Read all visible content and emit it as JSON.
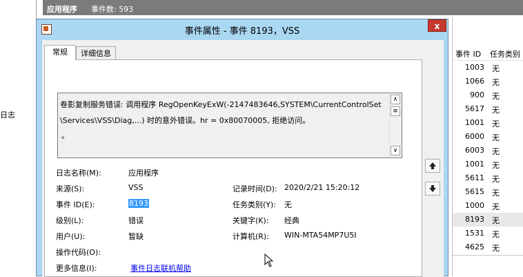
{
  "left_pane": {
    "text": "日志"
  },
  "topbar": {
    "log_name": "应用程序",
    "event_count": "事件数: 593"
  },
  "right_pane": {
    "col_event_id": "事件 ID",
    "col_task": "任务类别",
    "rows": [
      {
        "id": "1003",
        "task": "无"
      },
      {
        "id": "1066",
        "task": "无"
      },
      {
        "id": "900",
        "task": "无"
      },
      {
        "id": "5617",
        "task": "无"
      },
      {
        "id": "1001",
        "task": "无"
      },
      {
        "id": "6000",
        "task": "无"
      },
      {
        "id": "6003",
        "task": "无"
      },
      {
        "id": "1001",
        "task": "无"
      },
      {
        "id": "5611",
        "task": "无"
      },
      {
        "id": "5615",
        "task": "无"
      },
      {
        "id": "1000",
        "task": "无"
      },
      {
        "id": "8193",
        "task": "无"
      },
      {
        "id": "1531",
        "task": "无"
      },
      {
        "id": "4625",
        "task": "无"
      }
    ],
    "selected_index": 11
  },
  "dialog": {
    "title": "事件属性 - 事件 8193，VSS",
    "close_label": "x",
    "tabs": [
      "常规",
      "详细信息"
    ],
    "description_line1": "卷影复制服务错误: 调用程序 RegOpenKeyExW(-2147483646,SYSTEM\\CurrentControlSet",
    "description_line2": "\\Services\\VSS\\Diag,...) 时的意外错误。hr = 0x80070005, 拒绝访问。",
    "description_line3": "。",
    "fields": {
      "log_name_label": "日志名称(M):",
      "log_name_value": "应用程序",
      "source_label": "来源(S):",
      "source_value": "VSS",
      "logged_label": "记录时间(D):",
      "logged_value": "2020/2/21 15:20:12",
      "event_id_label": "事件 ID(E):",
      "event_id_value": "8193",
      "task_label": "任务类别(Y):",
      "task_value": "无",
      "level_label": "级别(L):",
      "level_value": "错误",
      "keywords_label": "关键字(K):",
      "keywords_value": "经典",
      "user_label": "用户(U):",
      "user_value": "暂缺",
      "computer_label": "计算机(R):",
      "computer_value": "WIN-MTA54MP7U5I",
      "opcode_label": "操作代码(O):",
      "opcode_value": "",
      "more_info_label": "更多信息(I):",
      "more_info_link": "事件日志联机帮助"
    }
  },
  "colors": {
    "title_bg": "#aad7f2",
    "close_bg": "#c6392e",
    "selection": "#3399ff",
    "link": "#0000ee"
  }
}
